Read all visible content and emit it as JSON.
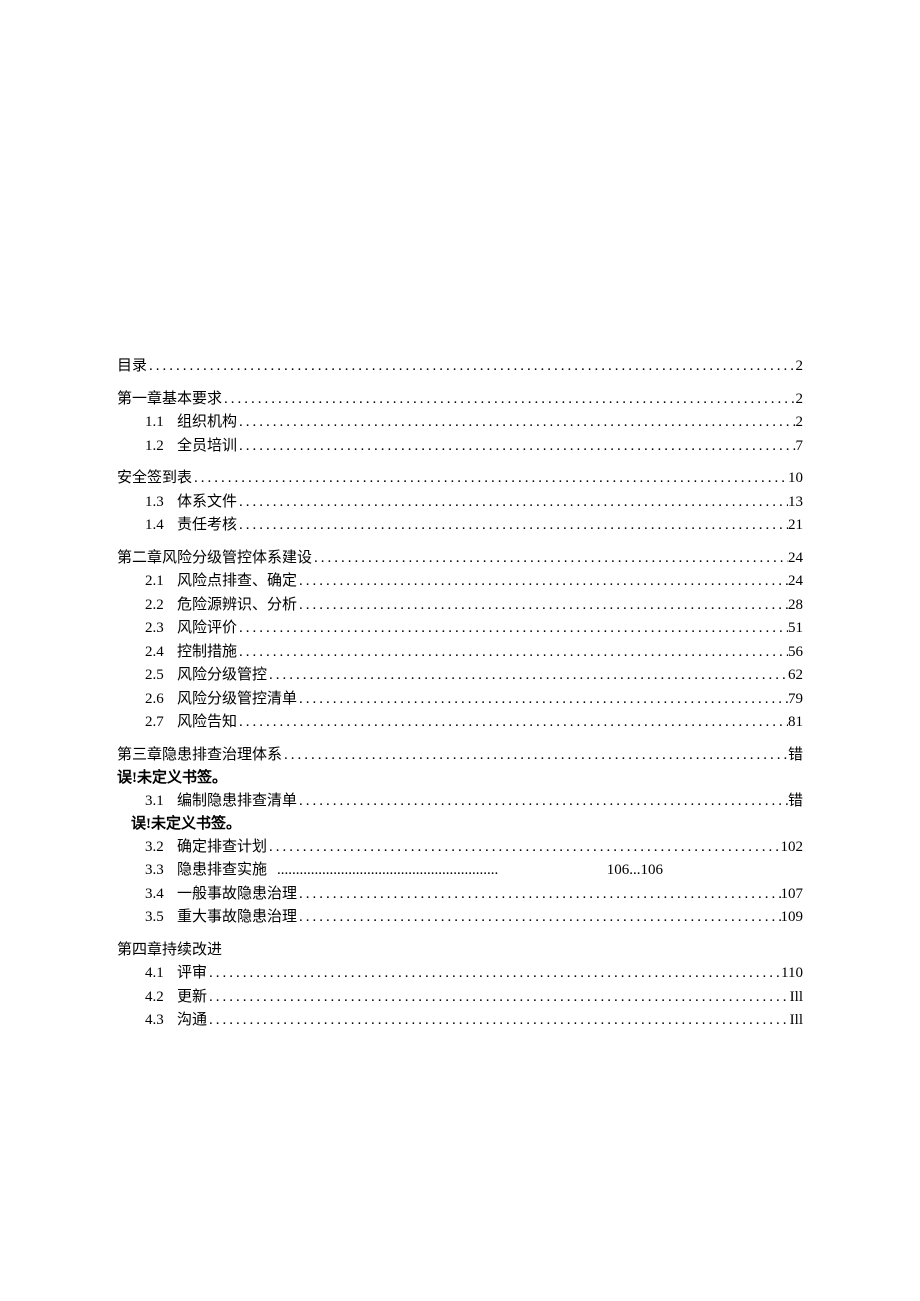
{
  "toc": {
    "standalone": {
      "title": "目录",
      "page": "2"
    },
    "chapter1": {
      "title": "第一章基本要求",
      "page": "2",
      "items": [
        {
          "num": "1.1",
          "title": "组织机构",
          "page": "2"
        },
        {
          "num": "1.2",
          "title": "全员培训",
          "page": "7"
        }
      ]
    },
    "safety": {
      "title": "安全签到表",
      "page": "10",
      "items": [
        {
          "num": "1.3",
          "title": "体系文件",
          "page": "13"
        },
        {
          "num": "1.4",
          "title": "责任考核",
          "page": "21"
        }
      ]
    },
    "chapter2": {
      "title": "第二章风险分级管控体系建设",
      "page": "24",
      "items": [
        {
          "num": "2.1",
          "title": "风险点排查、确定",
          "page": "24"
        },
        {
          "num": "2.2",
          "title": "危险源辨识、分析",
          "page": "28"
        },
        {
          "num": "2.3",
          "title": "风险评价",
          "page": "51"
        },
        {
          "num": "2.4",
          "title": "控制措施",
          "page": "56"
        },
        {
          "num": "2.5",
          "title": "风险分级管控",
          "page": "62"
        },
        {
          "num": "2.6",
          "title": "风险分级管控清单",
          "page": "79"
        },
        {
          "num": "2.7",
          "title": "风险告知",
          "page": "81"
        }
      ]
    },
    "chapter3": {
      "title": "第三章隐患排查治理体系",
      "page": "错",
      "wrap": "误!未定义书签。",
      "item31": {
        "num": "3.1",
        "title": "编制隐患排查清单",
        "page": "错",
        "wrap": "误!未定义书签。"
      },
      "items": [
        {
          "num": "3.2",
          "title": "确定排查计划",
          "page": "102"
        },
        {
          "num": "3.3",
          "title": "隐患排查实施",
          "page": "106...106"
        },
        {
          "num": "3.4",
          "title": "一般事故隐患治理",
          "page": "107"
        },
        {
          "num": "3.5",
          "title": "重大事故隐患治理",
          "page": "109"
        }
      ]
    },
    "chapter4": {
      "title": "第四章持续改进",
      "items": [
        {
          "num": "4.1",
          "title": "评审",
          "page": "110"
        },
        {
          "num": "4.2",
          "title": "更新",
          "page": "Ill"
        },
        {
          "num": "4.3",
          "title": "沟通",
          "page": "Ill"
        }
      ]
    }
  }
}
